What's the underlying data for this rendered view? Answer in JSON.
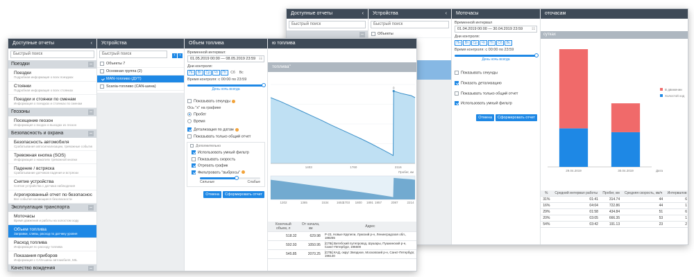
{
  "back": {
    "reports_header": "Доступные отчеты",
    "reports_search": "Быстрый поиск",
    "devices_header": "Устройства",
    "devices_search": "Быстрый поиск",
    "objects_label": "Объекты",
    "form_header": "Моточасы",
    "time_interval_label": "Временной интервал",
    "time_interval_value": "01.04.2019 00:00 — 30.04.2019 23:59",
    "control_days_label": "Дни контроля:",
    "days": [
      "Пн",
      "Вт",
      "Ср",
      "Чт",
      "Пт",
      "Сб",
      "Вс"
    ],
    "control_time_label": "Время контроля: с 00:00 по 23:59",
    "day_night_link": "День ночь всегда",
    "options": [
      "Показывать секунды",
      "Показать детализацию",
      "Показывать только общий отчет",
      "Использовать умный фильтр"
    ],
    "cancel": "Отмена",
    "generate": "Сформировать отчет",
    "report_title": "оточасам",
    "report_subtitle": "сутках",
    "chart_data": {
      "type": "bar",
      "categories": [
        "29.04.2019",
        "30.04.2019"
      ],
      "x_axis_end": "Дата",
      "series": [
        {
          "name": "В движении",
          "color": "#f06a6a",
          "values": [
            100,
            30
          ]
        },
        {
          "name": "Холостой ход",
          "color": "#1e88e5",
          "values": [
            40,
            36
          ]
        }
      ],
      "ylim": [
        0,
        115
      ]
    },
    "table": {
      "headers": [
        "%",
        "Средний интервал работы",
        "Пробег, км",
        "Средняя скорость, км/ч",
        "Интервалов"
      ],
      "rows": [
        [
          "31%",
          "01:41",
          "314.74",
          "44",
          "6"
        ],
        [
          "16%",
          "04:04",
          "722.86",
          "44",
          "1"
        ],
        [
          "29%",
          "01:58",
          "434.84",
          "51",
          "6"
        ],
        [
          "20%",
          "03:05",
          "666.35",
          "53",
          "1"
        ],
        [
          "54%",
          "03:42",
          "191.13",
          "23",
          "2"
        ]
      ]
    }
  },
  "front": {
    "reports_header": "Доступные отчеты",
    "reports_search": "Быстрый поиск",
    "sections": [
      {
        "label": "Поездки",
        "items": [
          {
            "title": "Поездки",
            "sub": "Подробная информация о всех поездках"
          },
          {
            "title": "Стоянки",
            "sub": "Подробная информация о всех стоянках"
          },
          {
            "title": "Поездки и стоянки по сменам",
            "sub": "Информация о поездках и стоянках по сменам"
          }
        ]
      },
      {
        "label": "Геозоны",
        "items": [
          {
            "title": "Посещение геозон",
            "sub": "Информация о входах и выходах из геозон"
          }
        ]
      },
      {
        "label": "Безопасность и охрана",
        "items": [
          {
            "title": "Безопасность автомобиля",
            "sub": "Срабатывания автосигнализации, тревожные события, выключение ДУТ"
          },
          {
            "title": "Тревожная кнопка (SOS)",
            "sub": "Информация о нажатиях тревожной кнопки"
          },
          {
            "title": "Падение / встряска",
            "sub": "Срабатывание датчиков падения и встряски"
          },
          {
            "title": "Снятие устройства",
            "sub": "Снятие устройства с датчика наблюдения"
          },
          {
            "title": "Агрегированный отчет по безопасности",
            "sub": "Все события касающиеся безопасности"
          }
        ]
      },
      {
        "label": "Эксплуатация транспорта",
        "items": [
          {
            "title": "Моточасы",
            "sub": "Время движения и работы на холостом ходу"
          },
          {
            "title": "Объем топлива",
            "sub": "Заправки, сливы, расход по датчику уровня",
            "active": true
          },
          {
            "title": "Расход топлива",
            "sub": "Информация по расходу топлива"
          },
          {
            "title": "Показания приборов",
            "sub": "Информация с CAN-шины автомобиля, MIL"
          }
        ]
      },
      {
        "label": "Качество вождения",
        "items": []
      }
    ],
    "devices_header": "Устройства",
    "devices_search": "Быстрый поиск",
    "devices": [
      {
        "label": "Объекты 7",
        "checked": false,
        "active": false
      },
      {
        "label": "Основная группа (2)",
        "checked": false,
        "active": false
      },
      {
        "label": "MAN-топливо (ДУТ)",
        "checked": true,
        "active": true
      },
      {
        "label": "Scania-топливо (CAN-шина)",
        "checked": false,
        "active": false
      }
    ],
    "form_header": "Объем топлива",
    "time_interval_label": "Временной интервал:",
    "time_interval_value": "01.05.2019 00:00 — 08.05.2019 23:59",
    "control_days_label": "Дни контроля:",
    "days": [
      "Пн",
      "Вт",
      "Ср",
      "Чт",
      "Пт",
      "Сб",
      "Вс"
    ],
    "control_time_label": "Время контроля: с 00:00 по 23:59",
    "day_night_link": "День ночь всегда",
    "show_seconds": "Показывать секунды",
    "x_axis_label": "Ось \"x\" на графике",
    "axis_options": [
      "Пробег",
      "Время"
    ],
    "detail_by_date": "Детализация по датам",
    "only_total": "Показывать только общий отчет",
    "extra_label": "Дополнительно",
    "extra_options": [
      {
        "label": "Использовать умный фильтр",
        "checked": true
      },
      {
        "label": "Показывать скорость",
        "checked": false
      },
      {
        "label": "Отрезать график",
        "checked": true
      },
      {
        "label": "Фильтровать \"выбросы\"",
        "checked": true
      }
    ],
    "strong": "Сильные",
    "weak": "Слабые",
    "cancel": "Отмена",
    "generate": "Сформировать отчет",
    "report_header": "ю топлива",
    "chart_title": "топлива\"",
    "chart_data": {
      "type": "line",
      "xlabel": "Пробег, км",
      "x_ticks": [
        1403,
        1760,
        2116
      ],
      "mini_ticks": [
        1202,
        1365,
        1534,
        1653,
        1703,
        1800,
        1891,
        1957,
        2087,
        2214,
        2359
      ],
      "points": [
        [
          1100,
          200
        ],
        [
          1180,
          188
        ],
        [
          1260,
          174
        ],
        [
          1340,
          160
        ],
        [
          1420,
          146
        ],
        [
          1500,
          132
        ],
        [
          1580,
          117
        ],
        [
          1660,
          103
        ],
        [
          1740,
          89
        ],
        [
          1820,
          75
        ],
        [
          1900,
          60
        ],
        [
          1980,
          44
        ],
        [
          2050,
          30
        ],
        [
          2076,
          24
        ],
        [
          2080,
          220
        ],
        [
          2150,
          212
        ],
        [
          2220,
          206
        ],
        [
          2250,
          200
        ]
      ],
      "peak_label": "0"
    },
    "table": {
      "headers": [
        "Конечный объем, л",
        "От начала, км",
        "Адрес"
      ],
      "rows": [
        [
          "518.32",
          "629.98",
          "Р-23, Новые Крупели, Лужский р-н, Ленинградская обл., 188255"
        ],
        [
          "592.93",
          "1050.95",
          "[СПБ] Витебский путепровод, Шушары, Пушкинский р-н, Санкт-Петербург, 196600"
        ],
        [
          "545.85",
          "2070.25",
          "[СПБ] КАД, округ Звездное, Московский р-н, Санкт-Петербург, 196140"
        ]
      ]
    }
  }
}
